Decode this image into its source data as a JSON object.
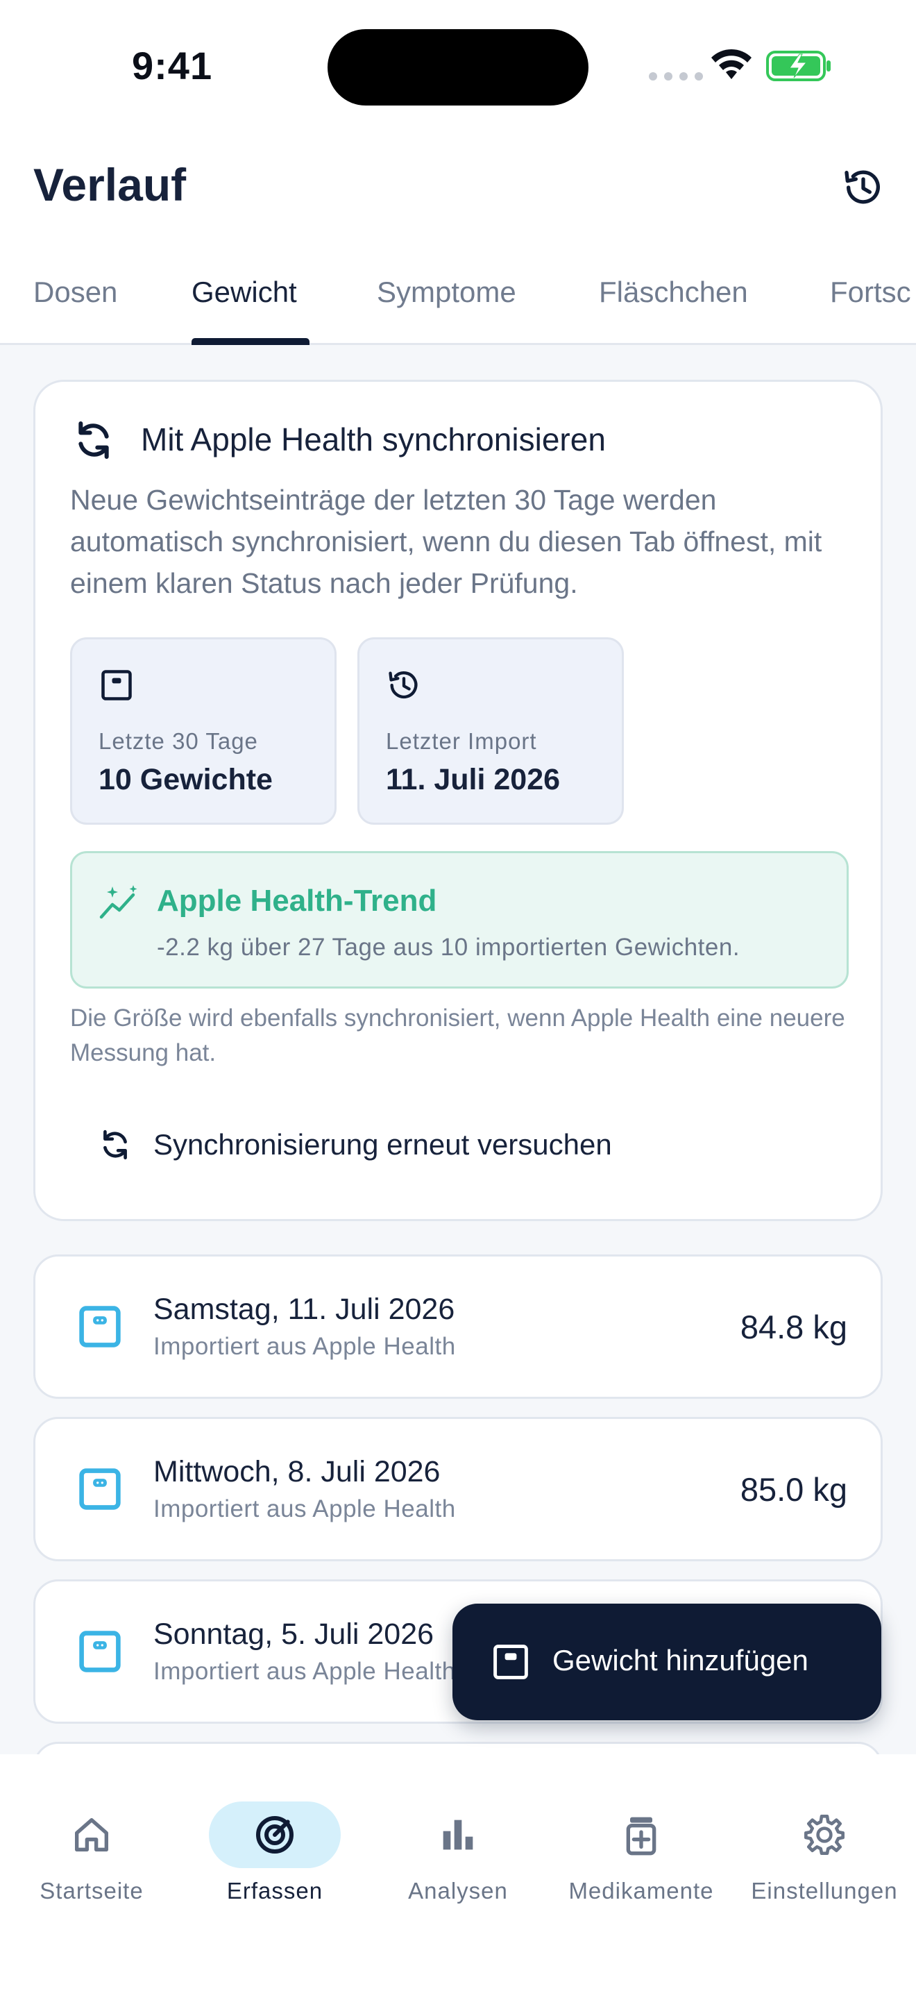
{
  "status_bar": {
    "time": "9:41"
  },
  "header": {
    "title": "Verlauf",
    "history_icon": "history-icon"
  },
  "tabs": [
    {
      "label": "Dosen",
      "active": false
    },
    {
      "label": "Gewicht",
      "active": true
    },
    {
      "label": "Symptome",
      "active": false
    },
    {
      "label": "Fläschchen",
      "active": false
    },
    {
      "label": "Fortsc",
      "active": false
    }
  ],
  "sync_card": {
    "title": "Mit Apple Health synchronisieren",
    "description": "Neue Gewichtseinträge der letzten 30 Tage werden automatisch synchronisiert, wenn du diesen Tab öffnest, mit einem klaren Status nach jeder Prüfung.",
    "stats": [
      {
        "icon": "scale-icon",
        "label": "Letzte 30 Tage",
        "value": "10 Gewichte"
      },
      {
        "icon": "history-icon",
        "label": "Letzter Import",
        "value": "11. Juli 2026"
      }
    ],
    "trend": {
      "icon": "trend-sparkle-icon",
      "title": "Apple Health-Trend",
      "description": "-2.2 kg über 27 Tage aus 10 importierten Gewichten."
    },
    "size_note": "Die Größe wird ebenfalls synchronisiert, wenn Apple Health eine neuere Messung hat.",
    "retry_label": "Synchronisierung erneut versuchen"
  },
  "entries": [
    {
      "date": "Samstag, 11. Juli 2026",
      "source": "Importiert aus Apple Health",
      "weight": "84.8 kg"
    },
    {
      "date": "Mittwoch, 8. Juli 2026",
      "source": "Importiert aus Apple Health",
      "weight": "85.0 kg"
    },
    {
      "date": "Sonntag, 5. Juli 2026",
      "source": "Importiert aus Apple Health",
      "weight": ""
    }
  ],
  "fab": {
    "label": "Gewicht hinzufügen"
  },
  "bottom_nav": [
    {
      "label": "Startseite",
      "icon": "home-icon",
      "active": false
    },
    {
      "label": "Erfassen",
      "icon": "target-icon",
      "active": true
    },
    {
      "label": "Analysen",
      "icon": "bar-chart-icon",
      "active": false
    },
    {
      "label": "Medikamente",
      "icon": "medication-icon",
      "active": false
    },
    {
      "label": "Einstellungen",
      "icon": "gear-icon",
      "active": false
    }
  ],
  "colors": {
    "primary": "#0f1b34",
    "accent_teal": "#2fb18a",
    "scale_blue": "#3bb4e5",
    "active_nav_bg": "#d5f0fb",
    "battery_green": "#34c759"
  }
}
